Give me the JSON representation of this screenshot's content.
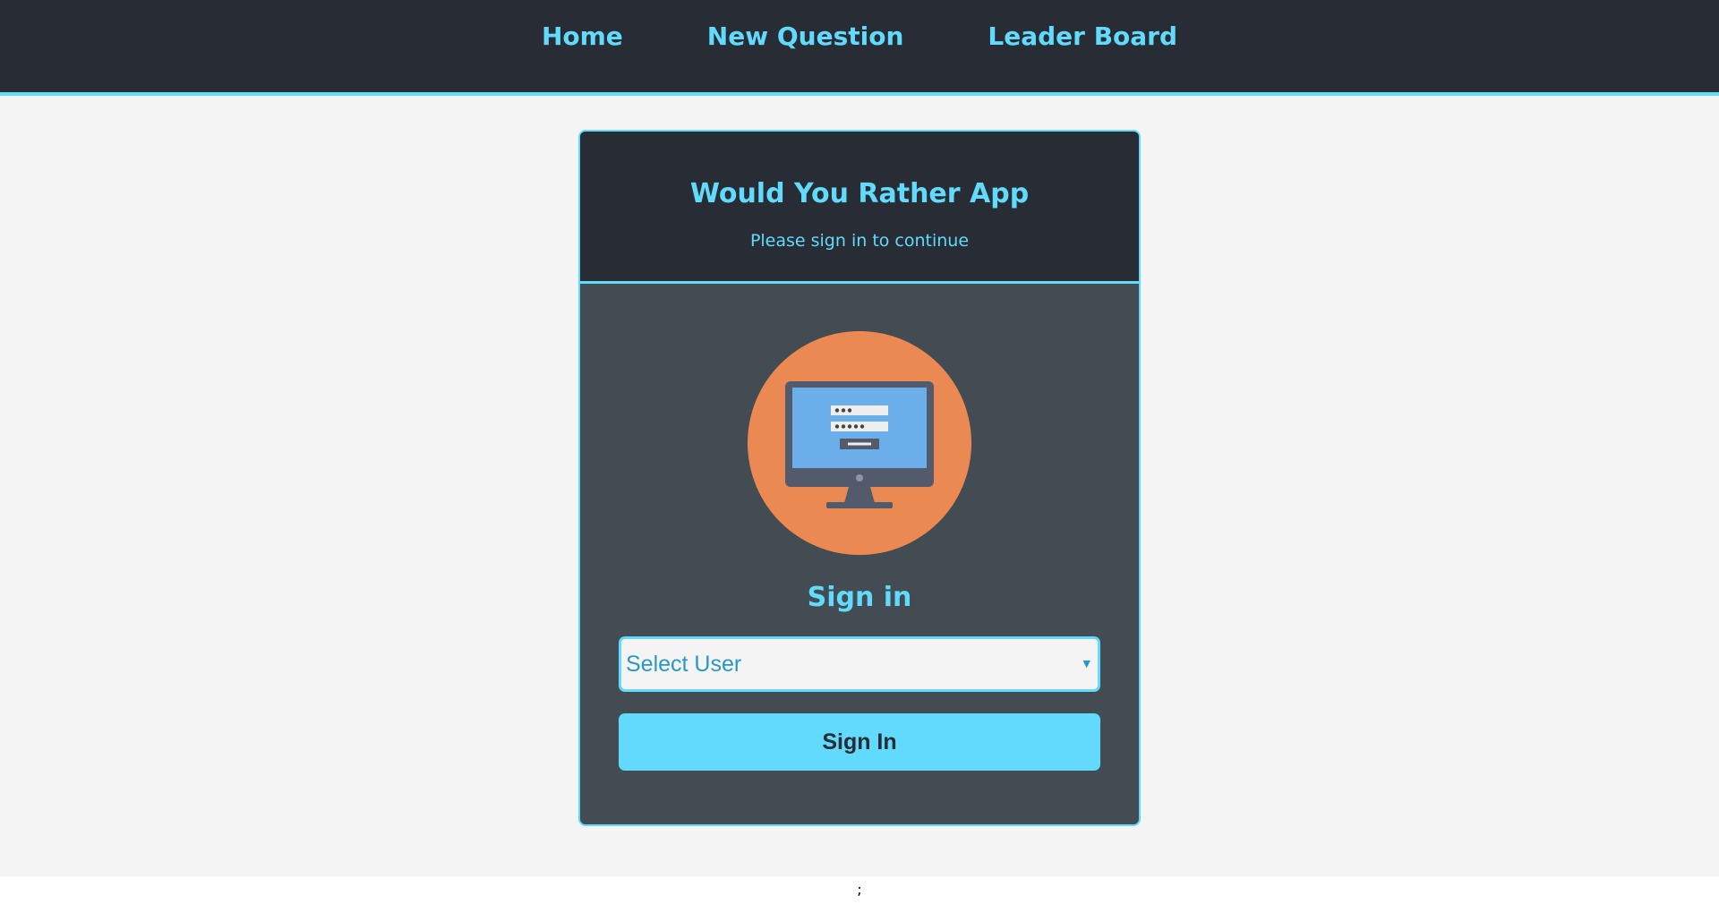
{
  "nav": {
    "home": "Home",
    "new_question": "New Question",
    "leader_board": "Leader Board"
  },
  "card": {
    "title": "Would You Rather App",
    "subtitle": "Please sign in to continue",
    "illustration": "computer-login-icon",
    "signin_heading": "Sign in",
    "select": {
      "value": "Select User"
    },
    "button_label": "Sign In"
  },
  "footer": {
    "text": ";"
  },
  "colors": {
    "accent": "#61dafb",
    "dark": "#282c34",
    "card_body": "#434b53",
    "page_bg": "#f4f4f4",
    "illustration_circle": "#ea8a52"
  }
}
